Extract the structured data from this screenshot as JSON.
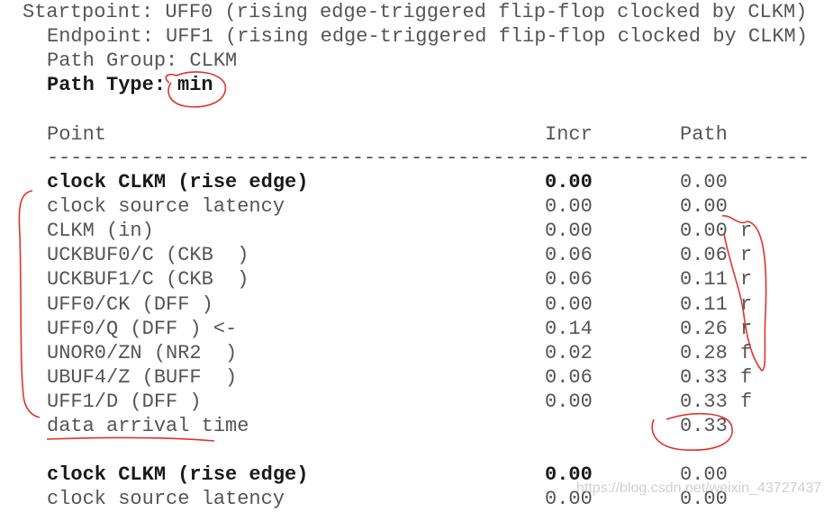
{
  "header": {
    "startpoint": "Startpoint: UFF0 (rising edge-triggered flip-flop clocked by CLKM)",
    "endpoint": "Endpoint: UFF1 (rising edge-triggered flip-flop clocked by CLKM)",
    "path_group": "Path Group: CLKM",
    "path_type_label": "Path Type:",
    "path_type_value": "min"
  },
  "columns": {
    "point": "Point",
    "incr": "Incr",
    "path": "Path"
  },
  "separator": "-----------------------------------------------------------------",
  "rows": [
    {
      "point": "clock CLKM (rise edge)",
      "incr": "0.00",
      "path": "0.00",
      "flag": "",
      "bold": true
    },
    {
      "point": "clock source latency",
      "incr": "0.00",
      "path": "0.00",
      "flag": ""
    },
    {
      "point": "CLKM (in)",
      "incr": "0.00",
      "path": "0.00",
      "flag": "r"
    },
    {
      "point": "UCKBUF0/C (CKB  )",
      "incr": "0.06",
      "path": "0.06",
      "flag": "r"
    },
    {
      "point": "UCKBUF1/C (CKB  )",
      "incr": "0.06",
      "path": "0.11",
      "flag": "r"
    },
    {
      "point": "UFF0/CK (DFF )",
      "incr": "0.00",
      "path": "0.11",
      "flag": "r"
    },
    {
      "point": "UFF0/Q (DFF ) <-",
      "incr": "0.14",
      "path": "0.26",
      "flag": "r"
    },
    {
      "point": "UNOR0/ZN (NR2  )",
      "incr": "0.02",
      "path": "0.28",
      "flag": "f"
    },
    {
      "point": "UBUF4/Z (BUFF  )",
      "incr": "0.06",
      "path": "0.33",
      "flag": "f"
    },
    {
      "point": "UFF1/D (DFF )",
      "incr": "0.00",
      "path": "0.33",
      "flag": "f"
    },
    {
      "point": "data arrival time",
      "incr": "",
      "path": "0.33",
      "flag": ""
    },
    {
      "point": "",
      "incr": "",
      "path": "",
      "flag": ""
    },
    {
      "point": "clock CLKM (rise edge)",
      "incr": "0.00",
      "path": "0.00",
      "flag": "",
      "bold": true
    },
    {
      "point": "clock source latency",
      "incr": "0.00",
      "path": "0.00",
      "flag": ""
    }
  ],
  "watermark": "https://blog.csdn.net/weixin_43727437",
  "annotation_color": "#e0342c"
}
